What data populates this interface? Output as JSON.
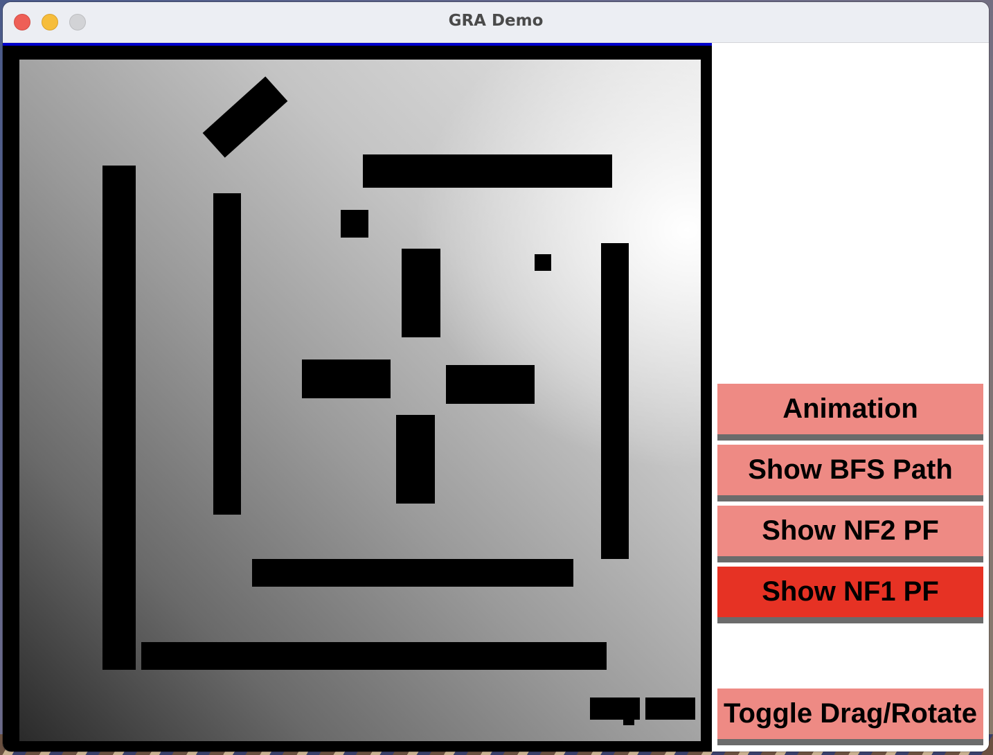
{
  "window": {
    "title": "GRA Demo"
  },
  "canvas": {
    "description_icon": "potential-field-map"
  },
  "panel": {
    "buttons": [
      {
        "label": "Animation",
        "active": false
      },
      {
        "label": "Show BFS Path",
        "active": false
      },
      {
        "label": "Show NF2 PF",
        "active": false
      },
      {
        "label": "Show NF1 PF",
        "active": true
      },
      {
        "label": "Toggle Drag/Rotate",
        "active": false
      }
    ]
  },
  "colors": {
    "button_normal": "#ee8a84",
    "button_active": "#e63224",
    "button_shadow": "#6b6b6b",
    "frame_accent": "#0000cc"
  }
}
